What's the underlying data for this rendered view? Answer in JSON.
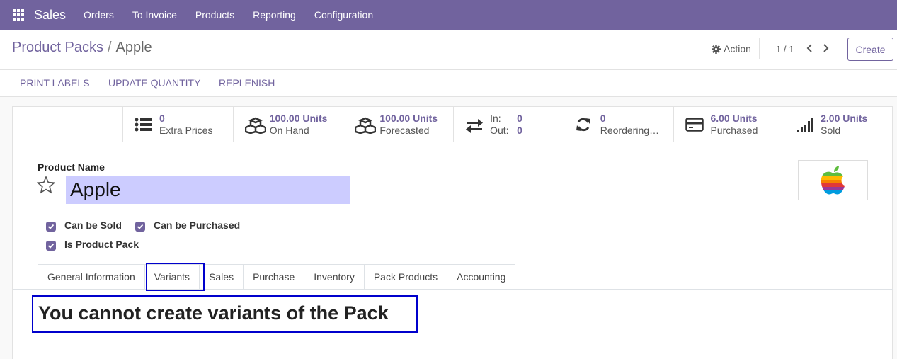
{
  "navbar": {
    "app_name": "Sales",
    "menu": [
      "Orders",
      "To Invoice",
      "Products",
      "Reporting",
      "Configuration"
    ]
  },
  "breadcrumb": {
    "parent": "Product Packs",
    "separator": "/",
    "current": "Apple"
  },
  "control": {
    "action_label": "Action",
    "pager": "1 / 1",
    "create_label": "Create"
  },
  "statusbar": {
    "buttons": [
      "PRINT LABELS",
      "UPDATE QUANTITY",
      "REPLENISH"
    ]
  },
  "smart_buttons": [
    {
      "value": "0",
      "label": "Extra Prices",
      "icon": "list-icon"
    },
    {
      "value": "100.00 Units",
      "label": "On Hand",
      "icon": "cubes-icon"
    },
    {
      "value": "100.00 Units",
      "label": "Forecasted",
      "icon": "cubes-icon"
    },
    {
      "in_label": "In:",
      "in_value": "0",
      "out_label": "Out:",
      "out_value": "0",
      "icon": "exchange-icon"
    },
    {
      "value": "0",
      "label": "Reordering…",
      "icon": "refresh-icon"
    },
    {
      "value": "6.00 Units",
      "label": "Purchased",
      "icon": "credit-card-icon"
    },
    {
      "value": "2.00 Units",
      "label": "Sold",
      "icon": "signal-icon"
    }
  ],
  "product": {
    "name_label": "Product Name",
    "name": "Apple",
    "image": "apple-logo"
  },
  "checkboxes": [
    {
      "label": "Can be Sold",
      "checked": true
    },
    {
      "label": "Can be Purchased",
      "checked": true
    },
    {
      "label": "Is Product Pack",
      "checked": true
    }
  ],
  "tabs": [
    "General Information",
    "Variants",
    "Sales",
    "Purchase",
    "Inventory",
    "Pack Products",
    "Accounting"
  ],
  "active_tab": "Variants",
  "variants_message": "You cannot create variants of the Pack",
  "colors": {
    "brand": "#71639e",
    "highlight": "#0000cc",
    "name_bg": "#ccccff"
  }
}
